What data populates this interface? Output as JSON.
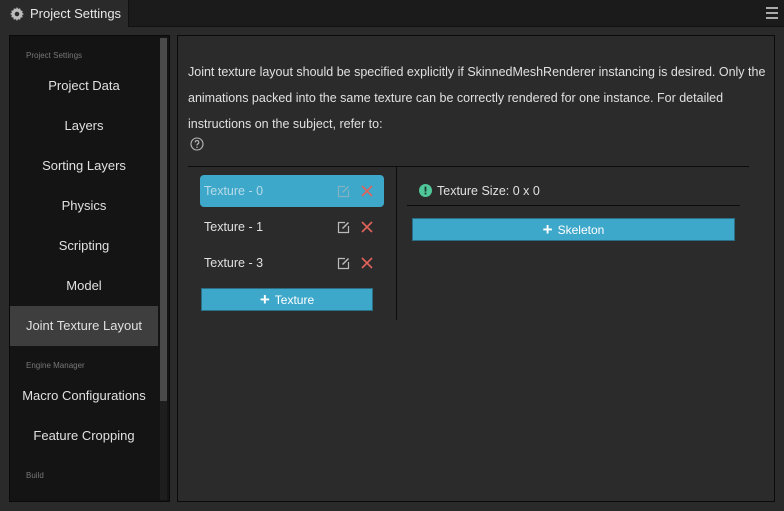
{
  "window": {
    "tab_title": "Project Settings",
    "tab_icon": "gear-icon",
    "menu_icon": "hamburger-menu-icon"
  },
  "sidebar": {
    "groups": [
      {
        "title": "Project Settings",
        "items": [
          {
            "label": "Project Data",
            "active": false
          },
          {
            "label": "Layers",
            "active": false
          },
          {
            "label": "Sorting Layers",
            "active": false
          },
          {
            "label": "Physics",
            "active": false
          },
          {
            "label": "Scripting",
            "active": false
          },
          {
            "label": "Model",
            "active": false
          },
          {
            "label": "Joint Texture Layout",
            "active": true
          }
        ]
      },
      {
        "title": "Engine Manager",
        "items": [
          {
            "label": "Macro Configurations",
            "active": false
          },
          {
            "label": "Feature Cropping",
            "active": false
          }
        ]
      },
      {
        "title": "Build",
        "items": []
      }
    ]
  },
  "main": {
    "description": "Joint texture layout should be specified explicitly if SkinnedMeshRenderer instancing is desired. Only the animations packed into the same texture can be correctly rendered for one instance. For detailed instructions on the subject, refer to:",
    "help_icon": "question-circle-icon",
    "textures": [
      {
        "label": "Texture - 0",
        "selected": true
      },
      {
        "label": "Texture - 1",
        "selected": false
      },
      {
        "label": "Texture - 3",
        "selected": false
      }
    ],
    "add_texture_label": "Texture",
    "texture_size_label": "Texture Size: 0 x 0",
    "add_skeleton_label": "Skeleton",
    "colors": {
      "accent": "#3ea8ca",
      "delete": "#e0625a",
      "info": "#4fc79a"
    }
  }
}
